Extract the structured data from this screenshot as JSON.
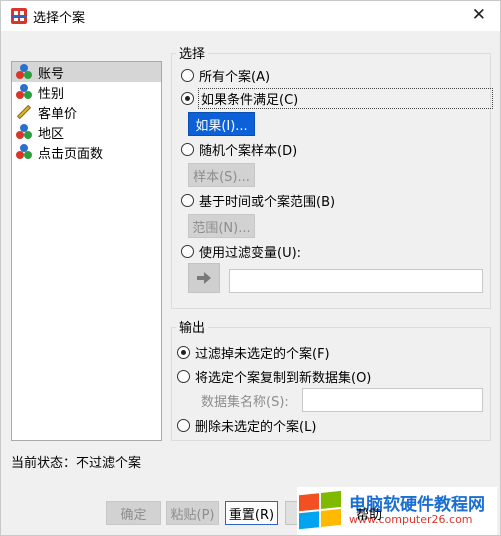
{
  "window": {
    "title": "选择个案",
    "close_glyph": "✕"
  },
  "variables": [
    {
      "label": "账号",
      "icon": "nominal-icon",
      "selected": true
    },
    {
      "label": "性别",
      "icon": "nominal-icon",
      "selected": false
    },
    {
      "label": "客单价",
      "icon": "scale-ruler-icon",
      "selected": false
    },
    {
      "label": "地区",
      "icon": "nominal-icon",
      "selected": false
    },
    {
      "label": "点击页面数",
      "icon": "nominal-icon",
      "selected": false
    }
  ],
  "select_group": {
    "label": "选择",
    "opt_all": "所有个案(A)",
    "opt_if": "如果条件满足(C)",
    "if_button": "如果(I)...",
    "opt_random": "随机个案样本(D)",
    "sample_button": "样本(S)...",
    "opt_range": "基于时间或个案范围(B)",
    "range_button": "范围(N)...",
    "opt_filter": "使用过滤变量(U):",
    "filter_value": "",
    "selected_option": "opt_if"
  },
  "output_group": {
    "label": "输出",
    "opt_filter_out": "过滤掉未选定的个案(F)",
    "opt_copy": "将选定个案复制到新数据集(O)",
    "dataset_label": "数据集名称(S):",
    "dataset_value": "",
    "opt_delete": "删除未选定的个案(L)",
    "selected_option": "opt_filter_out"
  },
  "status": "当前状态：不过滤个案",
  "buttons": {
    "ok": "确定",
    "paste": "粘贴(P)",
    "reset": "重置(R)",
    "help": "帮助"
  },
  "watermark": {
    "name": "电脑软硬件教程网",
    "url": "www.computer26.com"
  }
}
